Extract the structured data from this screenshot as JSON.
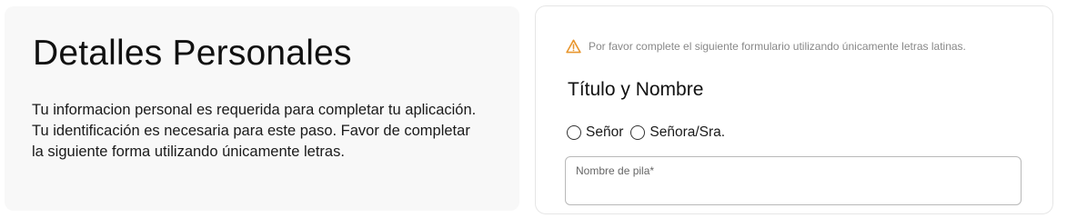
{
  "personal_details": {
    "title": "Detalles Personales",
    "intro_lines": [
      "Tu informacion personal es requerida para completar tu aplicación.",
      "Tu identificación es necesaria para este paso. Favor de completar",
      "la siguiente forma utilizando únicamente letras."
    ]
  },
  "form": {
    "warning": {
      "icon": "warning-triangle-icon",
      "color": "#e8962e",
      "text": "Por favor complete el siguiente formulario utilizando únicamente letras latinas."
    },
    "section_title": "Título y Nombre",
    "title_options": [
      {
        "label": "Señor",
        "selected": false
      },
      {
        "label": "Señora/Sra.",
        "selected": false
      }
    ],
    "first_name": {
      "label": "Nombre de pila*",
      "value": ""
    }
  }
}
